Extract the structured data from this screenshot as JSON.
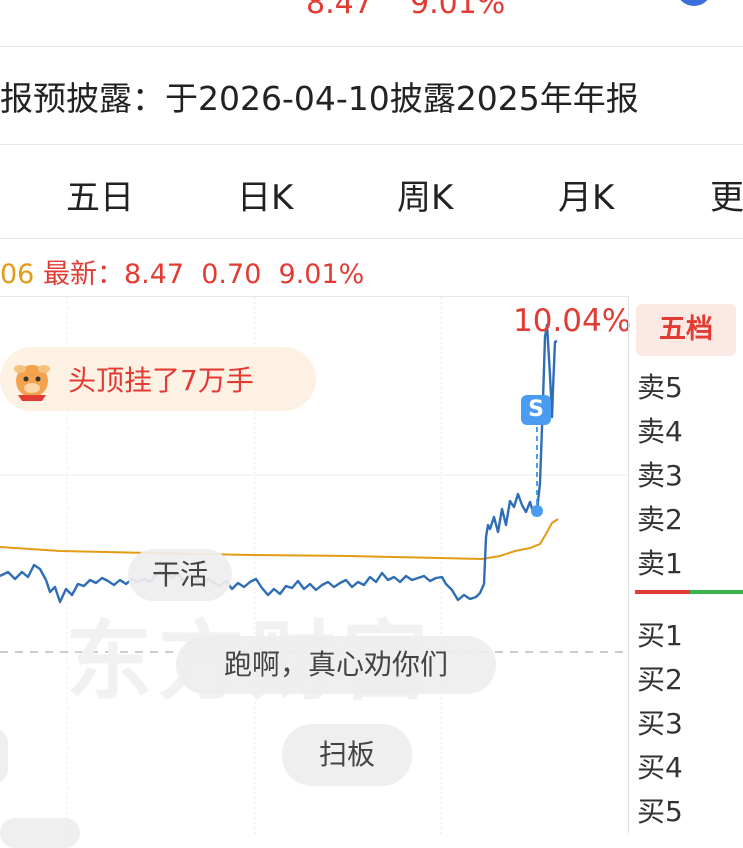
{
  "top_bar": {
    "price": "8.47",
    "percent": "9.01%"
  },
  "notice": "报预披露：于2026-04-10披露2025年年报",
  "tabs": [
    "五日",
    "日K",
    "周K",
    "月K",
    "更"
  ],
  "info_line": {
    "avg_value": "06",
    "latest_label": "最新：",
    "price": "8.47",
    "change": "0.70",
    "percent": "9.01%"
  },
  "chart": {
    "high_pct_label": "10.04%",
    "signal_badge": "S"
  },
  "promo": {
    "text": "头顶挂了7万手",
    "icon": "cow-mascot-icon"
  },
  "comments": [
    "干活",
    "跑啊，真心劝你们",
    "扫板"
  ],
  "watermark": "东方财富",
  "order_book": {
    "title": "五档",
    "sell": [
      "卖5",
      "卖4",
      "卖3",
      "卖2",
      "卖1"
    ],
    "buy": [
      "买1",
      "买2",
      "买3",
      "买4",
      "买5"
    ]
  },
  "colors": {
    "up_red": "#e23b33",
    "price_line": "#2f6db5",
    "avg_line": "#e59a16",
    "down_green": "#3cb34a"
  }
}
